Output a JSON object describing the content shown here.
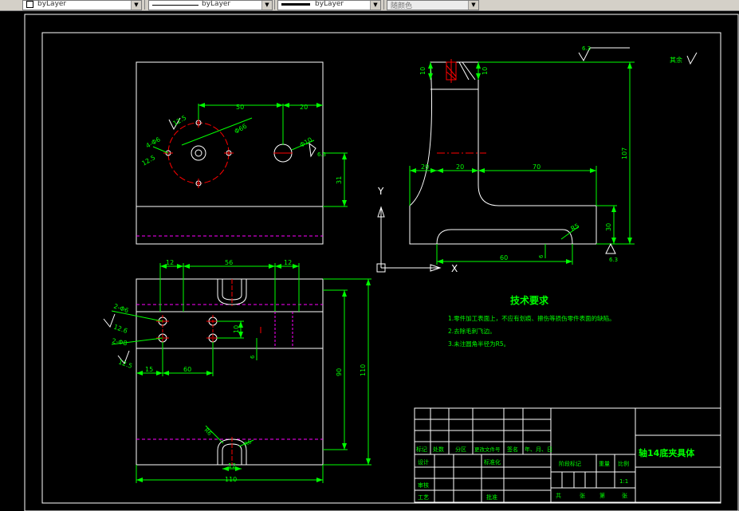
{
  "toolbar": {
    "color_combo": "byLayer",
    "linetype_combo": "byLayer",
    "lineweight_combo": "byLayer",
    "plotstyle_combo": "随颜色"
  },
  "drawing": {
    "dims_top": {
      "d50": "50",
      "d20": "20",
      "d31": "31",
      "d_dia": "Φ66",
      "d_hole": "4-Φ6",
      "d_rough": "12.5",
      "d_rough2": "12.5",
      "d_hole2": "Φ10"
    },
    "dims_side": {
      "d10a": "10",
      "d10b": "10",
      "d20a": "20",
      "d20b": "20",
      "d70": "70",
      "d107": "107",
      "d30": "30",
      "d60": "60",
      "d_r": "R5",
      "d6": "6",
      "rough1": "6.3",
      "rough2": "6.3"
    },
    "dims_bottom": {
      "d12a": "12",
      "d56": "56",
      "d12b": "12",
      "d90": "90",
      "d110": "110",
      "d10": "10",
      "d6": "6",
      "d15": "15",
      "d60": "60",
      "d110b": "110",
      "d12c": "12",
      "d_h1": "2-Φ6",
      "d_h2": "2-Φ8",
      "r1": "12.6",
      "r2": "12.5",
      "r_rad": "R6",
      "r_rad2": "R6"
    },
    "ucs": {
      "y": "Y",
      "x": "X"
    },
    "surface_note": "其余",
    "tech_title": "技术要求",
    "tech_items": [
      "1.零件加工表面上，不应有划痕、擦伤等损伤零件表面的缺陷。",
      "2.去除毛刺飞边。",
      "3.未注圆角半径为R5。"
    ],
    "title_block": {
      "part_name": "轴14底夹具体",
      "h_mark": "标记",
      "h_count": "处数",
      "h_zone": "分区",
      "h_doc": "更改文件号",
      "h_sign": "签名",
      "h_date": "年、月、日",
      "design": "设计",
      "std": "标准化",
      "stage": "阶段标记",
      "weight": "重量",
      "scale": "比例",
      "scale_val": "1:1",
      "review": "审核",
      "process": "工艺",
      "approve": "批准",
      "total": "共",
      "sheet_a": "张",
      "di": "第",
      "sheet_b": "张"
    }
  }
}
